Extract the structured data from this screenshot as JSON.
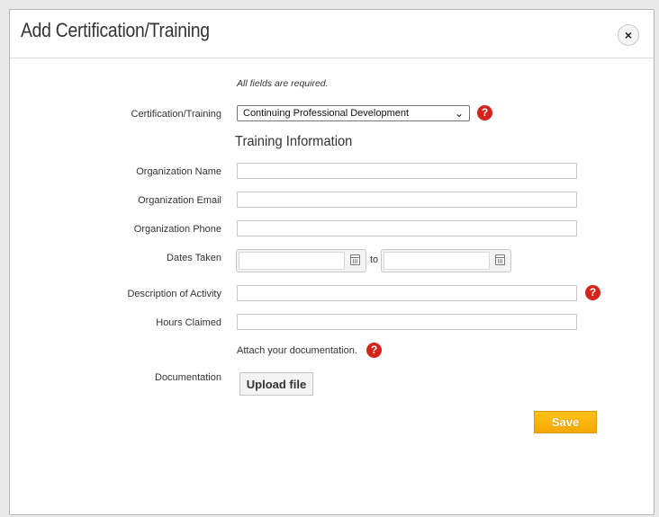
{
  "modal": {
    "title": "Add Certification/Training",
    "close_label": "×"
  },
  "form": {
    "required_note": "All fields are required.",
    "certification_label": "Certification/Training",
    "certification_value": "Continuing Professional Development",
    "section_title": "Training Information",
    "organization_name_label": "Organization Name",
    "organization_email_label": "Organization Email",
    "organization_phone_label": "Organization Phone",
    "dates_taken_label": "Dates Taken",
    "dates_to": "to",
    "description_label": "Description of Activity",
    "hours_label": "Hours Claimed",
    "attach_text": "Attach your documentation.",
    "documentation_label": "Documentation",
    "upload_label": "Upload file",
    "save_label": "Save",
    "help_glyph": "?",
    "chevron": "⌄"
  },
  "colors": {
    "accent_button": "#f5a800",
    "help_icon": "#d4231a"
  }
}
